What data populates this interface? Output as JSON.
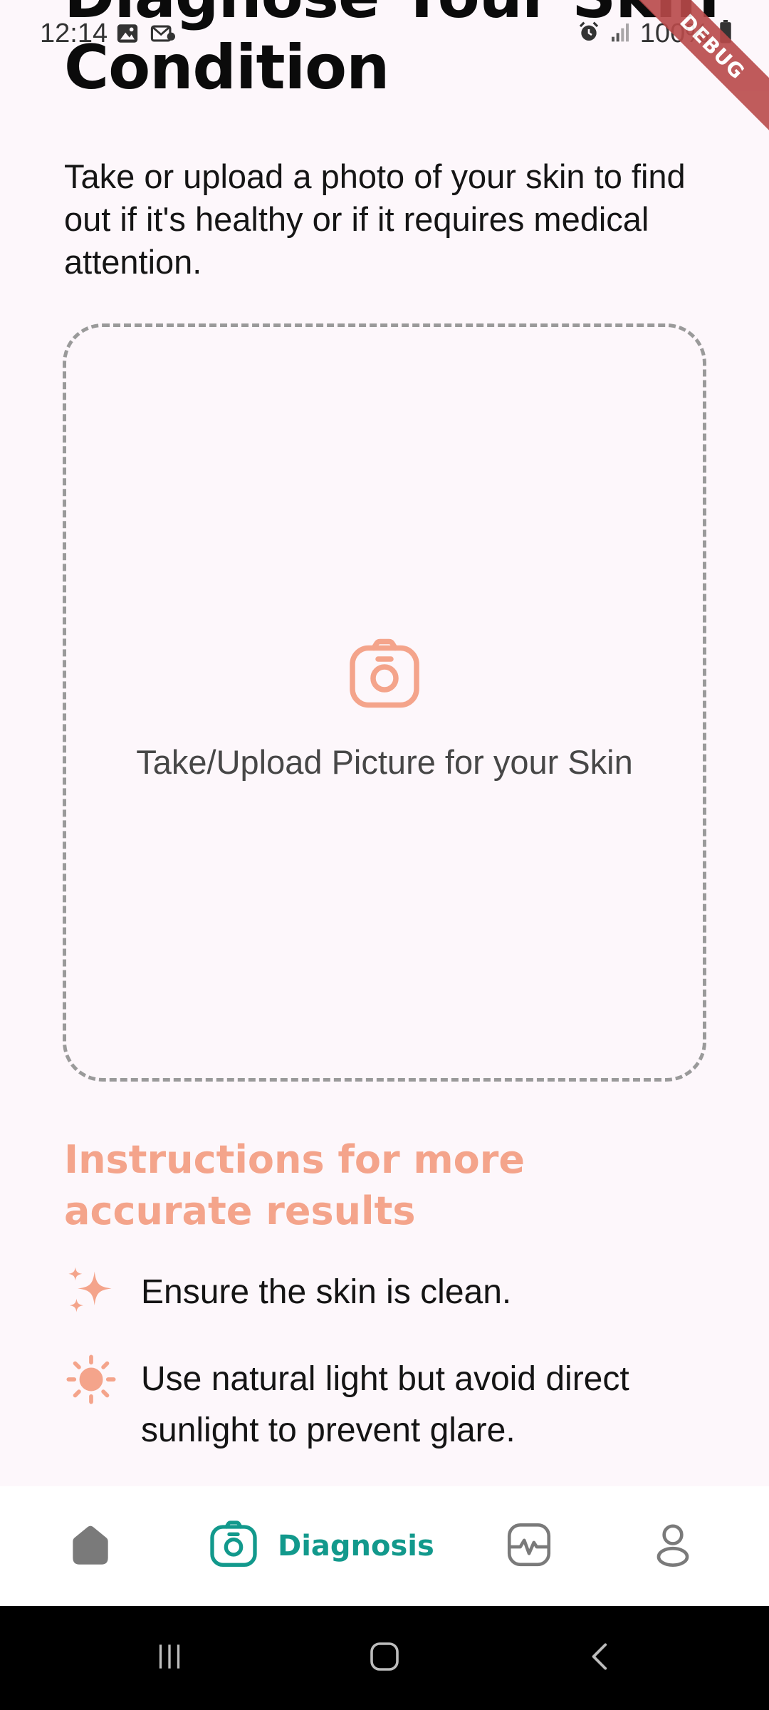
{
  "status_bar": {
    "time": "12:14",
    "battery": "100%",
    "left_icons": [
      "gallery-icon",
      "mail-notification-icon"
    ],
    "right_icons": [
      "alarm-icon",
      "signal-icon",
      "battery-icon"
    ]
  },
  "debug_banner": "DEBUG",
  "page": {
    "title": "Diagnose Your Skin Condition",
    "subtitle": "Take or upload a photo of your skin to find out if it's healthy or if it requires medical attention."
  },
  "upload": {
    "icon": "camera-icon",
    "label": "Take/Upload Picture for your Skin"
  },
  "instructions": {
    "heading": "Instructions for more accurate results",
    "items": [
      {
        "icon": "sparkle-icon",
        "text": "Ensure the skin is clean."
      },
      {
        "icon": "sun-icon",
        "text": "Use natural light but avoid direct sunlight to prevent glare."
      }
    ]
  },
  "bottom_nav": {
    "active": "diagnosis",
    "items": [
      {
        "id": "home",
        "icon": "home-icon",
        "label": ""
      },
      {
        "id": "diagnosis",
        "icon": "camera-icon",
        "label": "Diagnosis"
      },
      {
        "id": "monitor",
        "icon": "pulse-icon",
        "label": ""
      },
      {
        "id": "profile",
        "icon": "user-icon",
        "label": ""
      }
    ]
  },
  "colors": {
    "background": "#FDF7FB",
    "accent_peach": "#F4A48B",
    "accent_teal": "#12998C",
    "dashed_border": "#9A9A9A",
    "nav_inactive": "#7A7A7A"
  }
}
